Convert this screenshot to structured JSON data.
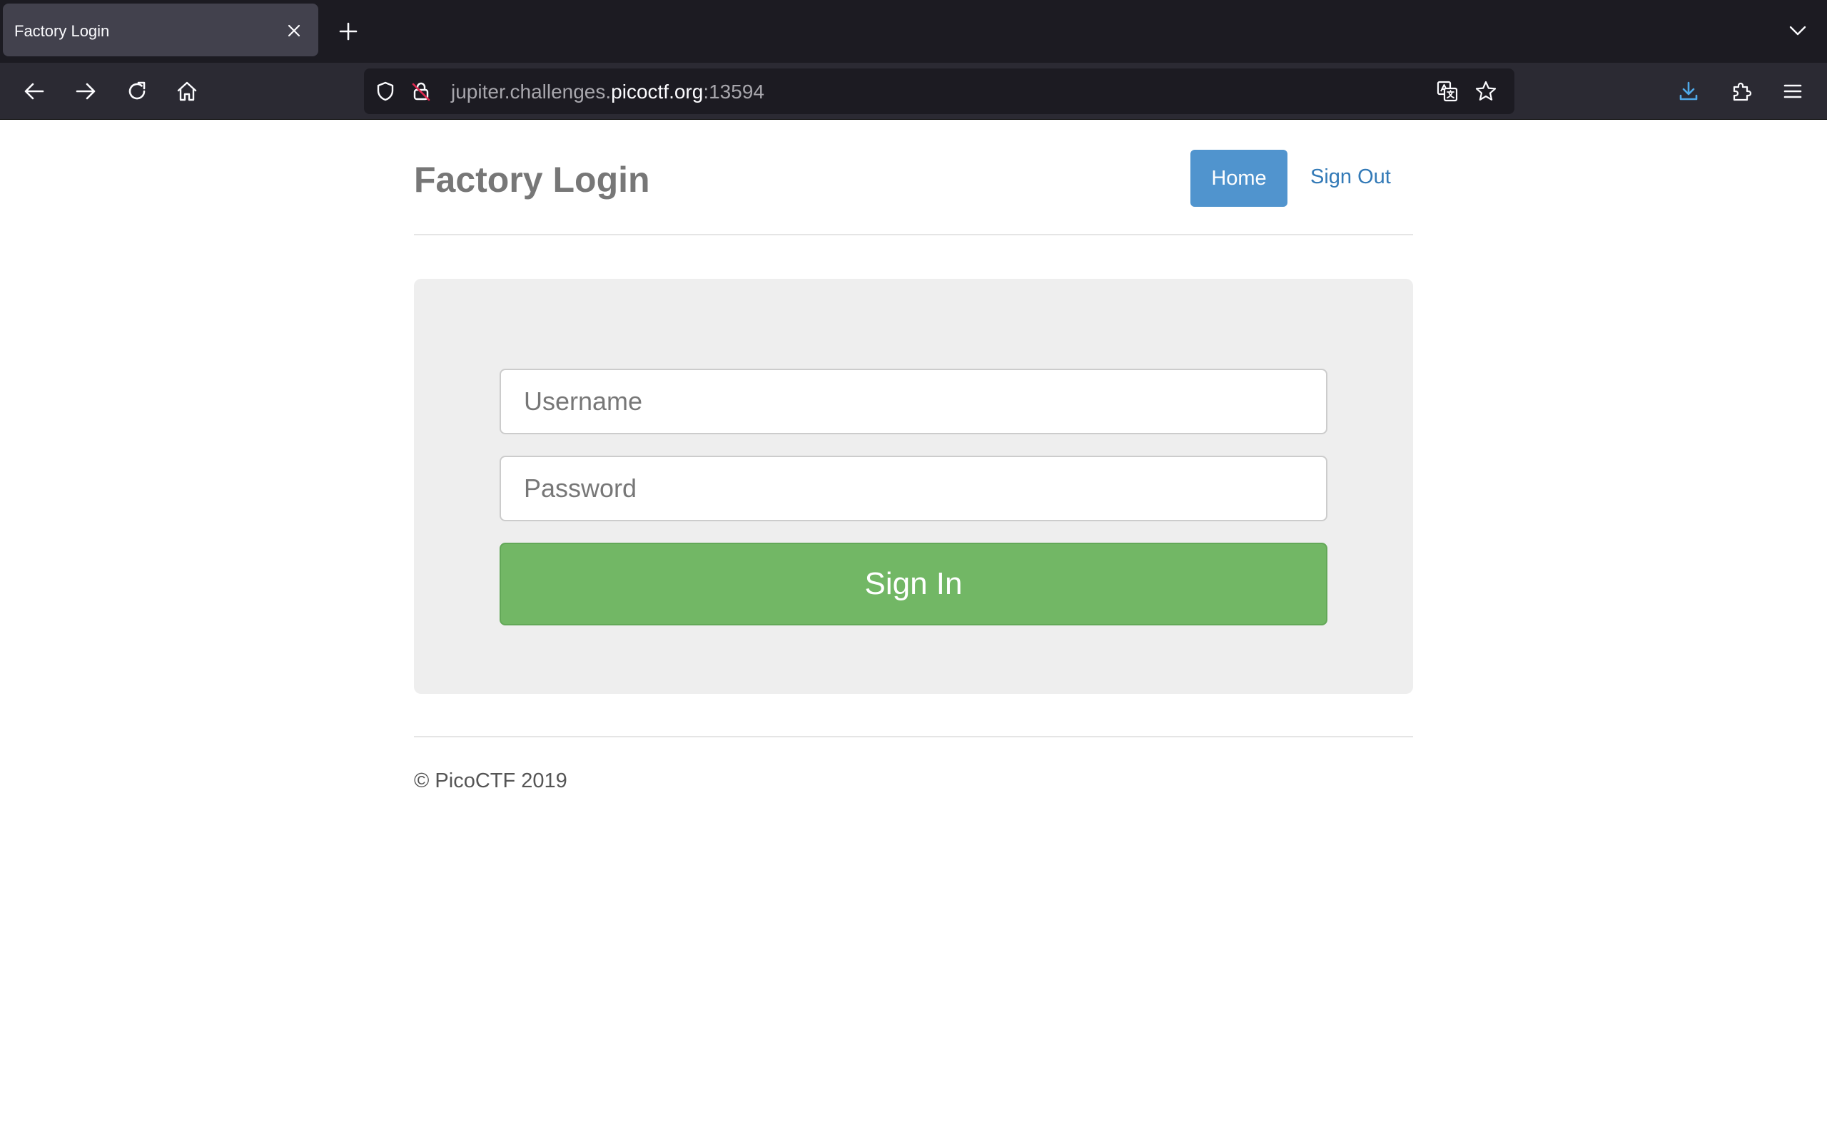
{
  "browser": {
    "tab": {
      "title": "Factory Login"
    },
    "url": {
      "prefix": "jupiter.challenges.",
      "domain": "picoctf.org",
      "suffix": ":13594"
    },
    "icons": {
      "tab_close": "close-icon",
      "new_tab": "plus-icon",
      "tab_list": "chevron-down-icon",
      "back": "arrow-left-icon",
      "forward": "arrow-right-icon",
      "reload": "reload-icon",
      "home": "home-icon",
      "shield": "shield-icon",
      "insecure_lock": "insecure-lock-icon",
      "translate": "translate-icon",
      "bookmark": "star-icon",
      "downloads": "download-icon",
      "extensions": "puzzle-icon",
      "menu": "hamburger-icon"
    }
  },
  "page": {
    "brand": "Factory Login",
    "nav": {
      "home": "Home",
      "sign_out": "Sign Out"
    },
    "form": {
      "username_placeholder": "Username",
      "password_placeholder": "Password",
      "submit": "Sign In"
    },
    "footer": "© PicoCTF 2019"
  },
  "colors": {
    "primary": "#428bca",
    "success": "#72b765",
    "link": "#337ab7",
    "brand_text": "#777777",
    "jumbotron": "#eeeeee"
  }
}
